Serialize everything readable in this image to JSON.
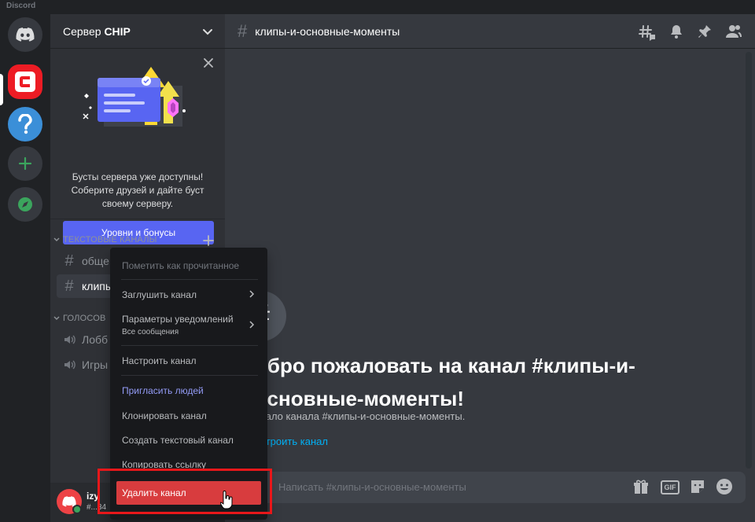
{
  "window": {
    "title": "Discord"
  },
  "colors": {
    "accent": "#5865f2",
    "danger": "#d83c3e",
    "online": "#3ba55d",
    "link": "#00b0f4",
    "server_chip": "#ed1c24"
  },
  "server": {
    "name_prefix": "Сервер ",
    "name_bold": "CHIP"
  },
  "boost": {
    "text": "Бусты сервера уже доступны! Соберите друзей и дайте буст своему серверу.",
    "button": "Уровни и бонусы"
  },
  "sidebar": {
    "text_category": "ТЕКСТОВЫЕ КАНАЛЫ",
    "voice_category": "ГОЛОСОВ",
    "text_channels": [
      "обще",
      "клипы"
    ],
    "voice_channels": [
      "Лобб",
      "Игры"
    ]
  },
  "user": {
    "name": "izy",
    "tag": "#...34"
  },
  "channel": {
    "name": "клипы-и-основные-моменты"
  },
  "welcome": {
    "title": "обро пожаловать на канал #клипы-и-основные-моменты!",
    "subtitle": "ачало канала #клипы-и-основные-моменты.",
    "link": "астроить канал"
  },
  "composer": {
    "placeholder": "Написать #клипы-и-основные-моменты",
    "gif_label": "GIF"
  },
  "context_menu": {
    "mark_read": "Пометить как прочитанное",
    "mute": "Заглушить канал",
    "notif_settings": "Параметры уведомлений",
    "notif_settings_sub": "Все сообщения",
    "configure": "Настроить канал",
    "invite": "Пригласить людей",
    "clone": "Клонировать канал",
    "create_text": "Создать текстовый канал",
    "copy_link": "Копировать ссылку",
    "delete": "Удалить канал"
  },
  "icons": {
    "home": "discord-logo-icon",
    "server": "chip-server-icon",
    "help": "help-icon",
    "add": "add-server-icon",
    "explore": "compass-icon",
    "threads": "threads-icon",
    "bell": "bell-icon",
    "pin": "pin-icon",
    "members": "members-icon",
    "gift": "gift-icon",
    "sticker": "sticker-icon",
    "emoji": "emoji-icon"
  }
}
